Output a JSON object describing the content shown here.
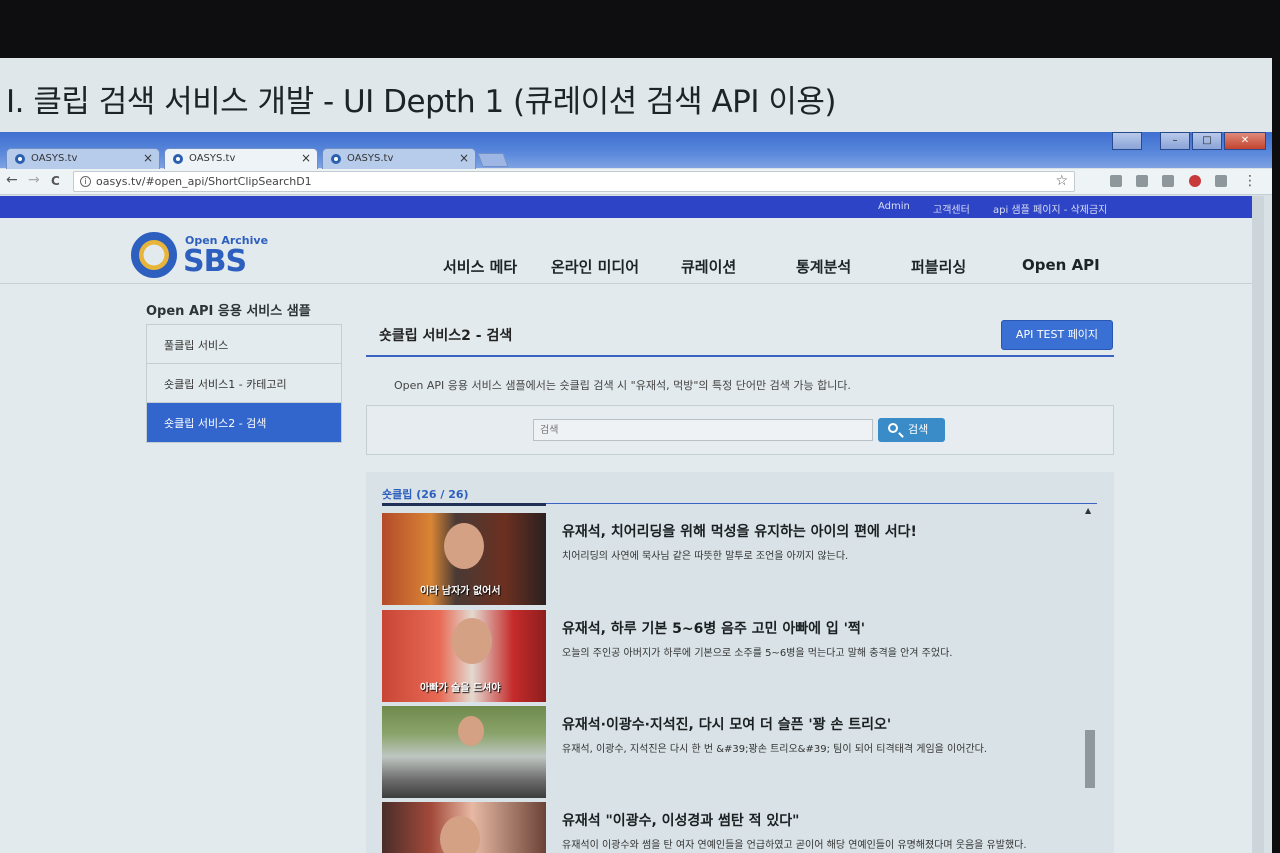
{
  "slide": {
    "title": "I. 클립 검색 서비스 개발 - UI Depth 1 (큐레이션 검색 API 이용)"
  },
  "browser": {
    "tabs": [
      {
        "label": "OASYS.tv",
        "active": false
      },
      {
        "label": "OASYS.tv",
        "active": true
      },
      {
        "label": "OASYS.tv",
        "active": false
      }
    ],
    "tab_close": "×",
    "url": "oasys.tv/#open_api/ShortClipSearchD1",
    "back_glyph": "←",
    "forward_glyph": "→",
    "reload_glyph": "C",
    "star_glyph": "☆",
    "menu_glyph": "⋮",
    "info_glyph": "i"
  },
  "utility_links": [
    "Admin",
    "고객센터",
    "api 샘플 페이지 - 삭제금지"
  ],
  "logo": {
    "small": "Open Archive",
    "big": "SBS"
  },
  "gnb": [
    "서비스 메타",
    "온라인 미디어",
    "큐레이션",
    "통계분석",
    "퍼블리싱",
    "Open API"
  ],
  "sidebar": {
    "title": "Open API 응용 서비스 샘플",
    "items": [
      {
        "label": "풀클립 서비스",
        "active": false
      },
      {
        "label": "숏클립 서비스1 - 카테고리",
        "active": false
      },
      {
        "label": "숏클립 서비스2 - 검색",
        "active": true
      }
    ]
  },
  "content": {
    "title": "숏클립 서비스2 - 검색",
    "api_button": "API TEST 페이지",
    "description": "Open API 응용 서비스 샘플에서는 숏클립 검색 시 \"유재석, 먹방\"의 특정 단어만 검색 가능 합니다.",
    "search": {
      "placeholder": "검색",
      "button": "검색"
    },
    "results_header": "숏클립 (26 / 26)",
    "results": [
      {
        "title": "유재석, 치어리딩을 위해 먹성을 유지하는 아이의 편에 서다!",
        "desc": "치어리딩의 사연에 묵사님 같은 따뜻한 말투로 조언을 아끼지 않는다.",
        "caption": "이라 남자가 없어서"
      },
      {
        "title": "유재석, 하루 기본 5~6병 음주 고민 아빠에 입 '쩍'",
        "desc": "오늘의 주인공 아버지가 하루에 기본으로 소주를 5~6병을 먹는다고 말해 충격을 안겨 주었다.",
        "caption": "아빠가 술을 드셔야"
      },
      {
        "title": "유재석·이광수·지석진, 다시 모여 더 슬픈 '꽝 손 트리오'",
        "desc": "유재석, 이광수, 지석진은 다시 한 번 &#39;꽝손 트리오&#39; 팀이 되어 티격태격 게임을 이어간다.",
        "caption": ""
      },
      {
        "title": "유재석 \"이광수, 이성경과 썸탄 적 있다\"",
        "desc": "유재석이 이광수와 썸을 탄 여자 연예인들을 언급하였고 곧이어 해당 연예인들이 유명해졌다며 웃음을 유발했다.",
        "caption": ""
      }
    ]
  },
  "colors": {
    "accent": "#3366cc",
    "util_bar": "#2e44c6",
    "search_button": "#3a8cc9"
  }
}
